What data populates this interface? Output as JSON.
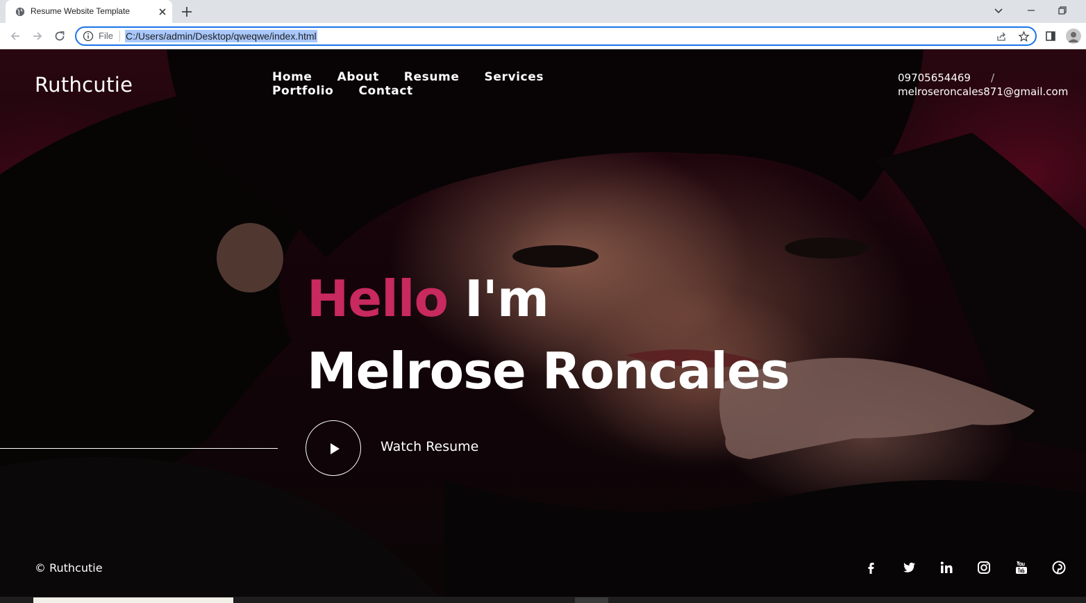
{
  "browser": {
    "tab_title": "Resume Website Template",
    "scheme_label": "File",
    "url": "C:/Users/admin/Desktop/qweqwe/index.html"
  },
  "site": {
    "logo": "Ruthcutie",
    "nav": [
      "Home",
      "About",
      "Resume",
      "Services",
      "Portfolio",
      "Contact"
    ],
    "phone": "09705654469",
    "separator": "/",
    "email": "melroseroncales871@gmail.com"
  },
  "hero": {
    "hello_accent": "Hello",
    "hello_rest": "I'm",
    "name": "Melrose Roncales",
    "watch_label": "Watch Resume"
  },
  "footer": {
    "copyright": "© Ruthcutie",
    "social_icons": [
      "facebook-icon",
      "twitter-icon",
      "linkedin-icon",
      "instagram-icon",
      "youtube-icon",
      "pinterest-icon"
    ]
  },
  "colors": {
    "accent": "#c8295f",
    "omnibox_border": "#1a73e8",
    "url_highlight": "#a8c7fa"
  }
}
